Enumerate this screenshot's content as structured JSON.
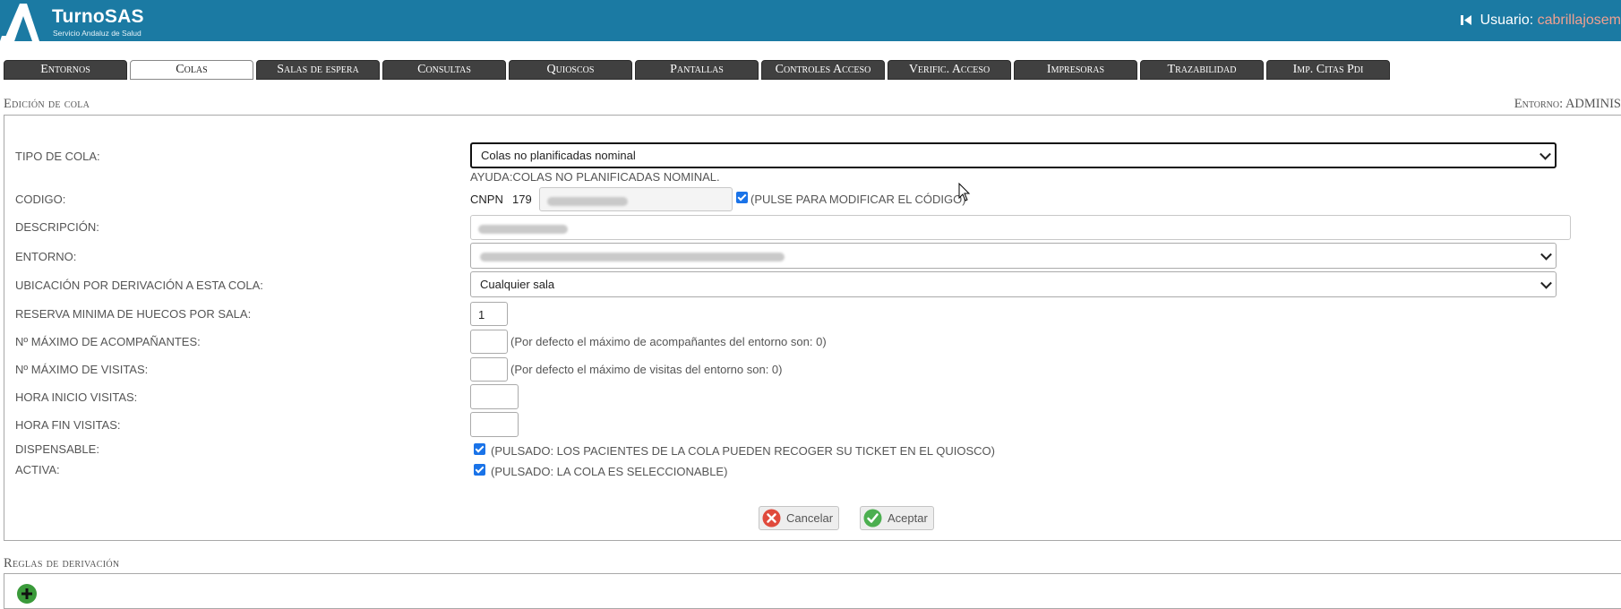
{
  "header": {
    "brand_name": "TurnoSAS",
    "brand_subtitle": "Servicio Andaluz de Salud",
    "user_label": "Usuario:",
    "user_name": "cabrillajosem"
  },
  "tabs": [
    {
      "label": "Entornos",
      "active": false
    },
    {
      "label": "Colas",
      "active": true
    },
    {
      "label": "Salas de espera",
      "active": false
    },
    {
      "label": "Consultas",
      "active": false
    },
    {
      "label": "Quioscos",
      "active": false
    },
    {
      "label": "Pantallas",
      "active": false
    },
    {
      "label": "Controles Acceso",
      "active": false
    },
    {
      "label": "Verific. Acceso",
      "active": false
    },
    {
      "label": "Impresoras",
      "active": false
    },
    {
      "label": "Trazabilidad",
      "active": false
    },
    {
      "label": "Imp. Citas Pdi",
      "active": false
    }
  ],
  "edit_section": {
    "title": "Edición de cola",
    "environment_label": "Entorno: ADMINIS"
  },
  "form": {
    "tipo_cola": {
      "label": "TIPO DE COLA:",
      "value": "Colas no planificadas nominal",
      "help": "AYUDA:COLAS NO PLANIFICADAS NOMINAL."
    },
    "codigo": {
      "label": "CODIGO:",
      "prefix": "CNPN",
      "number": "179",
      "modify_checked": true,
      "modify_hint": "(PULSE PARA MODIFICAR EL CÓDIGO)"
    },
    "descripcion": {
      "label": "DESCRIPCIÓN:"
    },
    "entorno": {
      "label": "ENTORNO:"
    },
    "ubicacion": {
      "label": "UBICACIÓN POR DERIVACIÓN A ESTA COLA:",
      "value": "Cualquier sala"
    },
    "reserva": {
      "label": "RESERVA MINIMA DE HUECOS POR SALA:",
      "value": "1"
    },
    "max_acompanantes": {
      "label": "Nº MÁXIMO DE ACOMPAÑANTES:",
      "value": "",
      "hint": "(Por defecto el máximo de acompañantes del entorno son: 0)"
    },
    "max_visitas": {
      "label": "Nº MÁXIMO DE VISITAS:",
      "value": "",
      "hint": "(Por defecto el máximo de visitas del entorno son: 0)"
    },
    "hora_inicio": {
      "label": "HORA INICIO VISITAS:",
      "value": ""
    },
    "hora_fin": {
      "label": "HORA FIN VISITAS:",
      "value": ""
    },
    "dispensable": {
      "label": "DISPENSABLE:",
      "checked": true,
      "hint": "(PULSADO: LOS PACIENTES DE LA COLA PUEDEN RECOGER SU TICKET EN EL QUIOSCO)"
    },
    "activa": {
      "label": "ACTIVA:",
      "checked": true,
      "hint": "(PULSADO: LA COLA ES SELECCIONABLE)"
    }
  },
  "actions": {
    "cancel_label": "Cancelar",
    "accept_label": "Aceptar"
  },
  "rules_section": {
    "title": "Reglas de derivación"
  },
  "colors": {
    "header_bg": "#1b7aa3",
    "tab_bg": "#404040",
    "checkbox": "#1a73e8",
    "cancel_icon": "#e04a3c",
    "accept_icon": "#4caf50"
  },
  "icons": [
    "brand-logo-icon",
    "logout-icon",
    "chevron-down-icon",
    "cancel-icon",
    "check-icon",
    "add-icon",
    "mouse-cursor-icon"
  ]
}
